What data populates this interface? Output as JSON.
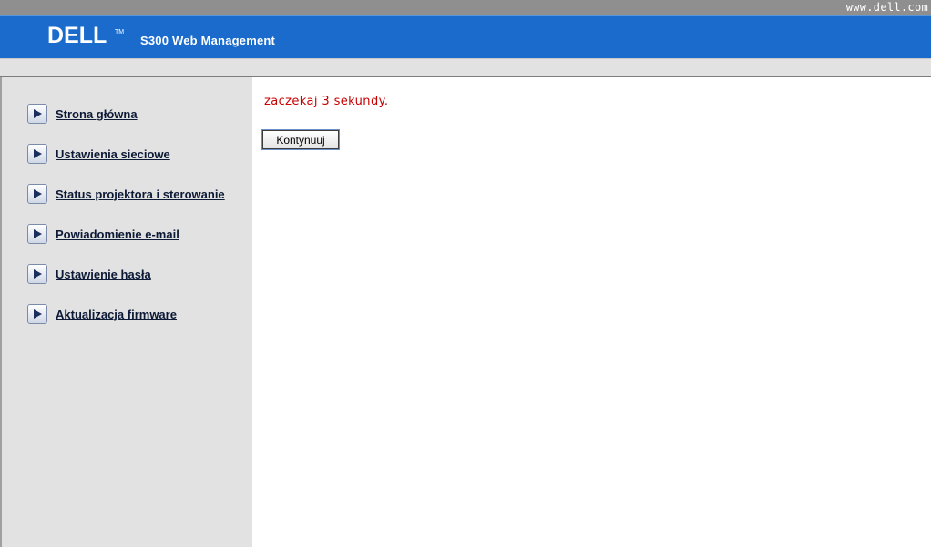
{
  "header": {
    "site_url": "www.dell.com",
    "logo_text": "DELL",
    "logo_tm": "TM",
    "app_title": "S300 Web Management"
  },
  "sidebar": {
    "items": [
      {
        "label": "Strona główna",
        "icon": "arrow-right-icon"
      },
      {
        "label": "Ustawienia sieciowe",
        "icon": "arrow-right-icon"
      },
      {
        "label": "Status projektora i sterowanie",
        "icon": "arrow-right-icon"
      },
      {
        "label": "Powiadomienie e-mail",
        "icon": "arrow-right-icon"
      },
      {
        "label": "Ustawienie hasła",
        "icon": "arrow-right-icon"
      },
      {
        "label": "Aktualizacja firmware",
        "icon": "arrow-right-icon"
      }
    ]
  },
  "main": {
    "message": "zaczekaj 3 sekundy.",
    "continue_label": "Kontynuuj"
  },
  "colors": {
    "banner_blue": "#1a6bcc",
    "message_red": "#c80000",
    "sidebar_gray": "#e2e2e2"
  }
}
